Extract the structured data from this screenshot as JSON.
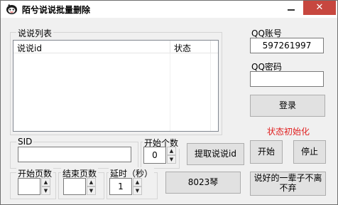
{
  "window": {
    "title": "陌兮说说批量删除",
    "minimize_glyph": "",
    "close_glyph": "✕"
  },
  "list": {
    "group_label": "说说列表",
    "columns": [
      "说说id",
      "状态"
    ]
  },
  "qq": {
    "account_label": "QQ账号",
    "account_value": "597261997",
    "password_label": "QQ密码",
    "password_value": "",
    "login_button": "登录",
    "status_text": "状态初始化",
    "status_color": "#e02020"
  },
  "sid": {
    "label": "SID",
    "value": ""
  },
  "start_count": {
    "label": "开始个数",
    "value": "0"
  },
  "extract_button": "提取说说id",
  "start_button": "开始",
  "stop_button": "停止",
  "start_page": {
    "label": "开始页数",
    "value": ""
  },
  "end_page": {
    "label": "结束页数",
    "value": ""
  },
  "delay": {
    "label": "延时（秒）",
    "value": "1"
  },
  "author_button": "8023琴",
  "quote_button": "说好的一辈子不离不弃",
  "icons": {
    "app": "cartoon-avatar-icon",
    "spin_up": "▲",
    "spin_down": "▼"
  }
}
